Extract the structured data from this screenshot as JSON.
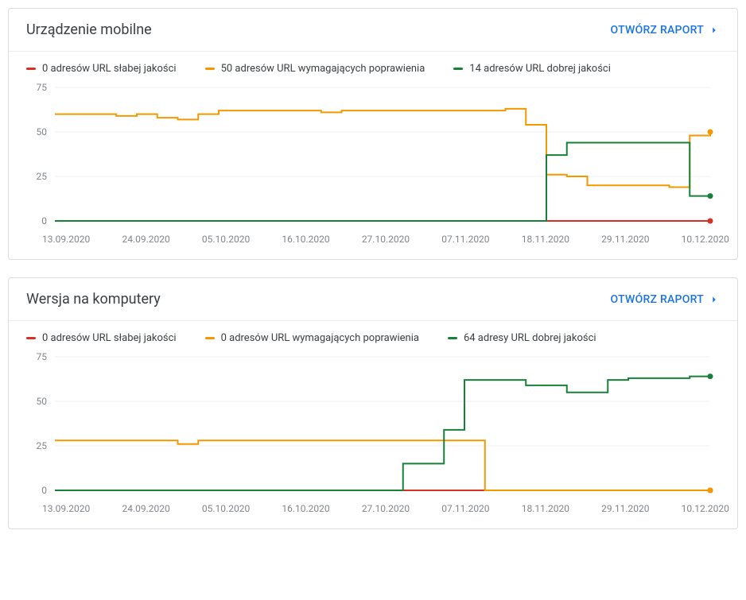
{
  "colors": {
    "poor": "#d93025",
    "improve": "#f29900",
    "good": "#188038",
    "axis": "#80868b"
  },
  "cards": [
    {
      "title": "Urządzenie mobilne",
      "open_label": "OTWÓRZ RAPORT",
      "legend": [
        {
          "key": "poor",
          "label": "0 adresów URL słabej jakości"
        },
        {
          "key": "improve",
          "label": "50 adresów URL wymagających poprawienia"
        },
        {
          "key": "good",
          "label": "14 adresów URL dobrej jakości"
        }
      ]
    },
    {
      "title": "Wersja na komputery",
      "open_label": "OTWÓRZ RAPORT",
      "legend": [
        {
          "key": "poor",
          "label": "0 adresów URL słabej jakości"
        },
        {
          "key": "improve",
          "label": "0 adresów URL wymagających poprawienia"
        },
        {
          "key": "good",
          "label": "64 adresy URL dobrej jakości"
        }
      ]
    }
  ],
  "chart_data": [
    {
      "type": "line",
      "title": "Urządzenie mobilne",
      "ylabel": "",
      "xlabel": "",
      "ylim": [
        0,
        75
      ],
      "y_ticks": [
        0,
        25,
        50,
        75
      ],
      "x_labels": [
        "13.09.2020",
        "24.09.2020",
        "05.10.2020",
        "16.10.2020",
        "27.10.2020",
        "07.11.2020",
        "18.11.2020",
        "29.11.2020",
        "10.12.2020"
      ],
      "x": [
        0,
        1,
        2,
        3,
        4,
        5,
        6,
        7,
        8,
        9,
        10,
        11,
        12,
        13,
        14,
        15,
        16,
        17,
        18,
        19,
        20,
        21,
        22,
        23,
        24,
        25,
        26,
        27,
        28,
        29,
        30,
        31,
        32
      ],
      "series": [
        {
          "name": "0 adresów URL słabej jakości",
          "key": "poor",
          "values": [
            0,
            0,
            0,
            0,
            0,
            0,
            0,
            0,
            0,
            0,
            0,
            0,
            0,
            0,
            0,
            0,
            0,
            0,
            0,
            0,
            0,
            0,
            0,
            0,
            0,
            0,
            0,
            0,
            0,
            0,
            0,
            0,
            0
          ]
        },
        {
          "name": "50 adresów URL wymagających poprawienia",
          "key": "improve",
          "values": [
            60,
            60,
            60,
            59,
            60,
            58,
            57,
            60,
            62,
            62,
            62,
            62,
            62,
            61,
            62,
            62,
            62,
            62,
            62,
            62,
            62,
            62,
            63,
            54,
            26,
            25,
            20,
            20,
            20,
            20,
            19,
            48,
            50
          ]
        },
        {
          "name": "14 adresów URL dobrej jakości",
          "key": "good",
          "values": [
            0,
            0,
            0,
            0,
            0,
            0,
            0,
            0,
            0,
            0,
            0,
            0,
            0,
            0,
            0,
            0,
            0,
            0,
            0,
            0,
            0,
            0,
            0,
            0,
            37,
            44,
            44,
            44,
            44,
            44,
            44,
            14,
            14
          ]
        }
      ]
    },
    {
      "type": "line",
      "title": "Wersja na komputery",
      "ylabel": "",
      "xlabel": "",
      "ylim": [
        0,
        75
      ],
      "y_ticks": [
        0,
        25,
        50,
        75
      ],
      "x_labels": [
        "13.09.2020",
        "24.09.2020",
        "05.10.2020",
        "16.10.2020",
        "27.10.2020",
        "07.11.2020",
        "18.11.2020",
        "29.11.2020",
        "10.12.2020"
      ],
      "x": [
        0,
        1,
        2,
        3,
        4,
        5,
        6,
        7,
        8,
        9,
        10,
        11,
        12,
        13,
        14,
        15,
        16,
        17,
        18,
        19,
        20,
        21,
        22,
        23,
        24,
        25,
        26,
        27,
        28,
        29,
        30,
        31,
        32
      ],
      "series": [
        {
          "name": "0 adresów URL słabej jakości",
          "key": "poor",
          "values": [
            0,
            0,
            0,
            0,
            0,
            0,
            0,
            0,
            0,
            0,
            0,
            0,
            0,
            0,
            0,
            0,
            0,
            0,
            0,
            0,
            0,
            0,
            0,
            0,
            0,
            0,
            0,
            0,
            0,
            0,
            0,
            0,
            0
          ]
        },
        {
          "name": "0 adresów URL wymagających poprawienia",
          "key": "improve",
          "values": [
            28,
            28,
            28,
            28,
            28,
            28,
            26,
            28,
            28,
            28,
            28,
            28,
            28,
            28,
            28,
            28,
            28,
            28,
            28,
            28,
            28,
            0,
            0,
            0,
            0,
            0,
            0,
            0,
            0,
            0,
            0,
            0,
            0
          ]
        },
        {
          "name": "64 adresy URL dobrej jakości",
          "key": "good",
          "values": [
            0,
            0,
            0,
            0,
            0,
            0,
            0,
            0,
            0,
            0,
            0,
            0,
            0,
            0,
            0,
            0,
            0,
            15,
            15,
            34,
            62,
            62,
            62,
            59,
            59,
            55,
            55,
            62,
            63,
            63,
            63,
            64,
            64
          ]
        }
      ]
    }
  ]
}
